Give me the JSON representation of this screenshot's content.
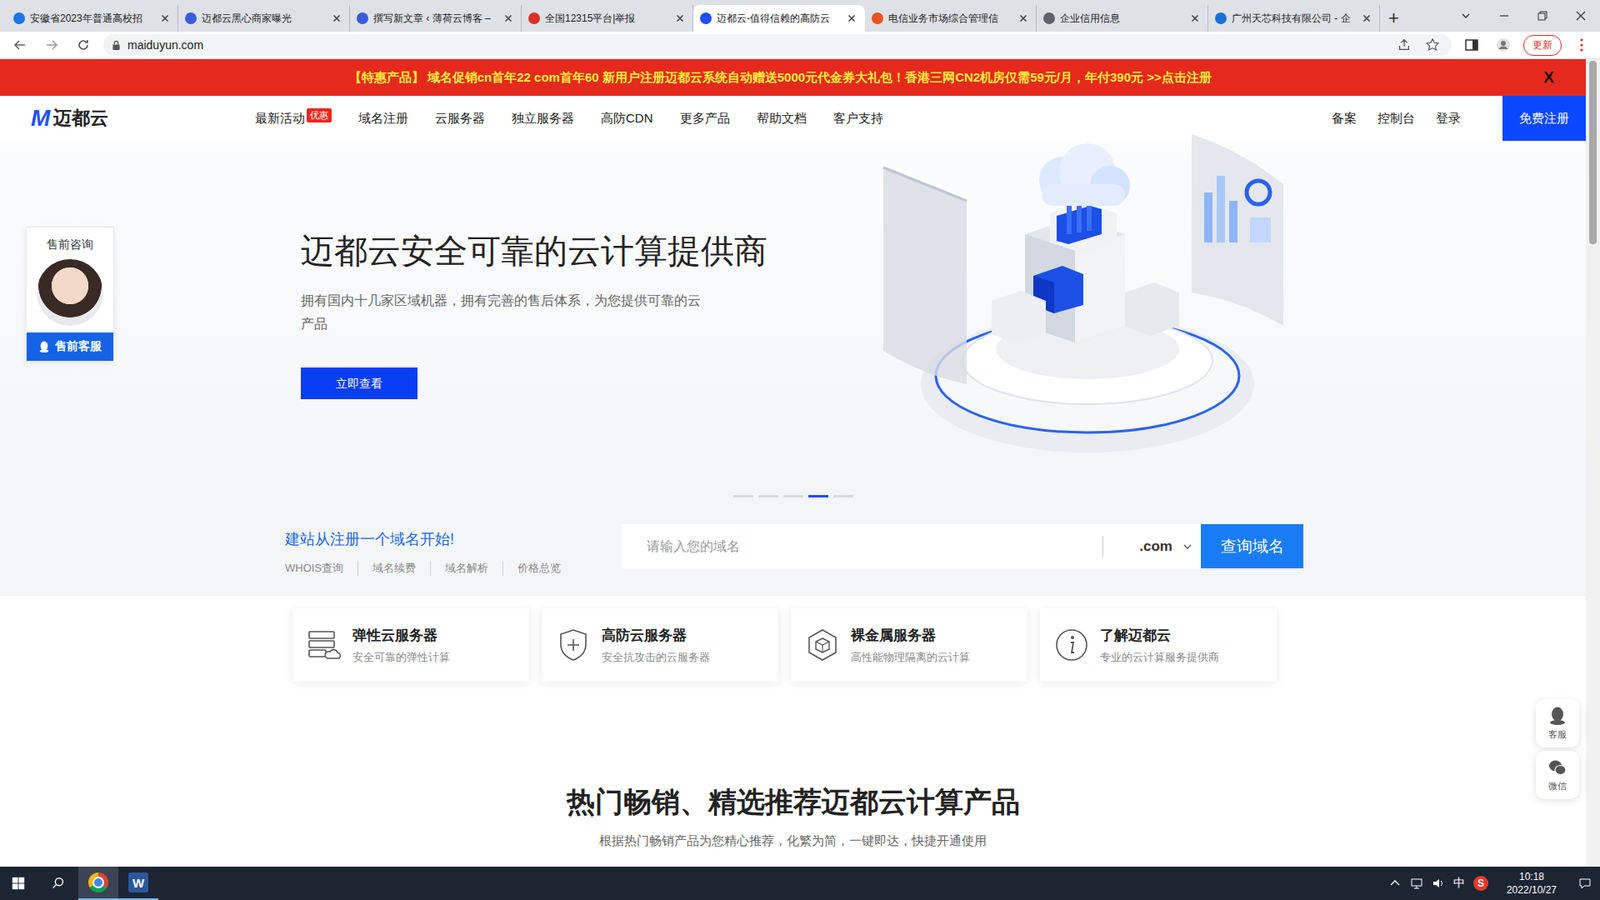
{
  "browser": {
    "tabs": [
      {
        "label": "安徽省2023年普通高校招",
        "selected": false,
        "color": "#1a73e8"
      },
      {
        "label": "迈都云黑心商家曝光",
        "selected": false,
        "color": "#3b5bdb"
      },
      {
        "label": "撰写新文章 ‹ 薄荷云博客 –",
        "selected": false,
        "color": "#3b5bdb"
      },
      {
        "label": "全国12315平台|举报",
        "selected": false,
        "color": "#d93025"
      },
      {
        "label": "迈都云-值得信赖的高防云",
        "selected": true,
        "color": "#1f4fff"
      },
      {
        "label": "电信业务市场综合管理信",
        "selected": false,
        "color": "#e8531f"
      },
      {
        "label": "企业信用信息",
        "selected": false,
        "color": "#5f6368"
      },
      {
        "label": "广州天芯科技有限公司 - 企",
        "selected": false,
        "color": "#1a6fd6"
      }
    ],
    "new_tab": "+",
    "url": "maiduyun.com",
    "update_button": "更新"
  },
  "banner": {
    "text": "【特惠产品】 域名促销cn首年22 com首年60 新用户注册迈都云系统自动赠送5000元代金券大礼包！香港三网CN2机房仅需59元/月，年付390元 >>点击注册",
    "close": "X"
  },
  "header": {
    "logo_mark": "M",
    "logo": "迈都云",
    "nav": [
      {
        "label": "最新活动",
        "badge": "优惠"
      },
      {
        "label": "域名注册"
      },
      {
        "label": "云服务器"
      },
      {
        "label": "独立服务器"
      },
      {
        "label": "高防CDN"
      },
      {
        "label": "更多产品"
      },
      {
        "label": "帮助文档"
      },
      {
        "label": "客户支持"
      }
    ],
    "links": [
      "备案",
      "控制台",
      "登录"
    ],
    "register": "免费注册"
  },
  "consult": {
    "title": "售前咨询",
    "button": "售前客服"
  },
  "hero": {
    "title": "迈都云安全可靠的云计算提供商",
    "description": "拥有国内十几家区域机器，拥有完善的售后体系，为您提供可靠的云产品",
    "button": "立即查看",
    "slides": [
      {
        "selected": false
      },
      {
        "selected": false
      },
      {
        "selected": false
      },
      {
        "selected": true
      },
      {
        "selected": false
      }
    ]
  },
  "domain": {
    "title": "建站从注册一个域名开始!",
    "links": [
      "WHOIS查询",
      "域名续费",
      "域名解析",
      "价格总览"
    ],
    "placeholder": "请输入您的域名",
    "suffix": ".com",
    "button": "查询域名"
  },
  "features": [
    {
      "kind": "server",
      "title": "弹性云服务器",
      "subtitle": "安全可靠的弹性计算"
    },
    {
      "kind": "shield",
      "title": "高防云服务器",
      "subtitle": "安全抗攻击的云服务器"
    },
    {
      "kind": "cube",
      "title": "裸金属服务器",
      "subtitle": "高性能物理隔离的云计算"
    },
    {
      "kind": "info",
      "title": "了解迈都云",
      "subtitle": "专业的云计算服务提供商"
    }
  ],
  "section": {
    "title": "热门畅销、精选推荐迈都云计算产品",
    "subtitle": "根据热门畅销产品为您精心推荐，化繁为简，一键即达，快捷开通使用"
  },
  "floats": [
    {
      "kind": "qq",
      "label": "客服"
    },
    {
      "kind": "wechat",
      "label": "微信"
    }
  ],
  "taskbar": {
    "apps": [
      {
        "kind": "chrome",
        "glyph": "",
        "selected": true
      },
      {
        "kind": "word",
        "glyph": "W",
        "selected": false
      }
    ],
    "ime": "中",
    "tray_app": "S",
    "time": "10:18",
    "date": "2022/10/27"
  }
}
